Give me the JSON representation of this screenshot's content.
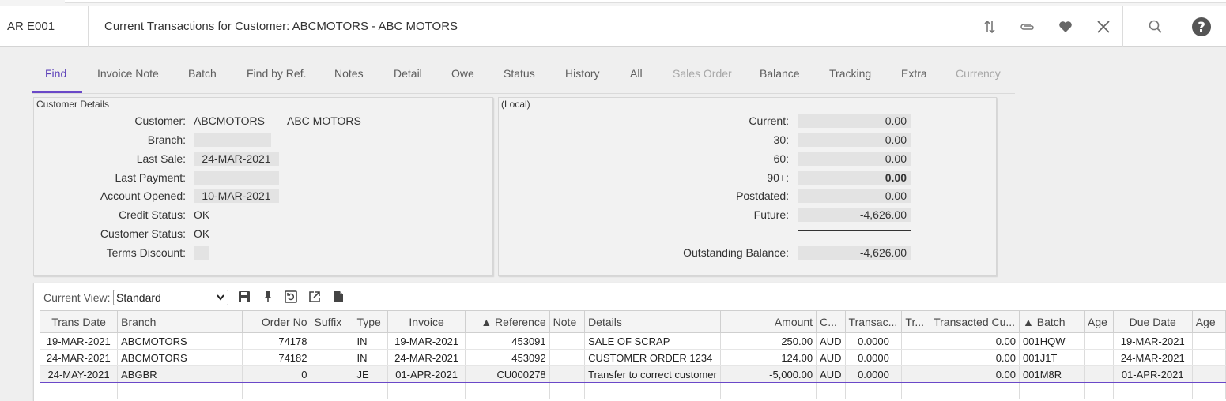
{
  "header": {
    "app_code": "AR E001",
    "title": "Current Transactions for Customer: ABCMOTORS - ABC MOTORS"
  },
  "tabs": [
    {
      "label": "Find"
    },
    {
      "label": "Invoice Note"
    },
    {
      "label": "Batch"
    },
    {
      "label": "Find by Ref."
    },
    {
      "label": "Notes"
    },
    {
      "label": "Detail"
    },
    {
      "label": "Owe"
    },
    {
      "label": "Status"
    },
    {
      "label": "History"
    },
    {
      "label": "All"
    },
    {
      "label": "Sales Order"
    },
    {
      "label": "Balance"
    },
    {
      "label": "Tracking"
    },
    {
      "label": "Extra"
    },
    {
      "label": "Currency"
    }
  ],
  "customer_details": {
    "title": "Customer Details",
    "customer_label": "Customer:",
    "customer_code": "ABCMOTORS",
    "customer_name": "ABC MOTORS",
    "branch_label": "Branch:",
    "branch": "",
    "last_sale_label": "Last Sale:",
    "last_sale": "24-MAR-2021",
    "last_payment_label": "Last Payment:",
    "last_payment": "",
    "account_opened_label": "Account Opened:",
    "account_opened": "10-MAR-2021",
    "credit_status_label": "Credit Status:",
    "credit_status": "OK",
    "customer_status_label": "Customer Status:",
    "customer_status": "OK",
    "terms_discount_label": "Terms Discount:",
    "terms_discount": ""
  },
  "aging": {
    "title": "(Local)",
    "current_label": "Current:",
    "current": "0.00",
    "d30_label": "30:",
    "d30": "0.00",
    "d60_label": "60:",
    "d60": "0.00",
    "d90_label": "90+:",
    "d90": "0.00",
    "postdated_label": "Postdated:",
    "postdated": "0.00",
    "future_label": "Future:",
    "future": "-4,626.00",
    "outstanding_label": "Outstanding Balance:",
    "outstanding": "-4,626.00"
  },
  "grid": {
    "current_view_label": "Current View:",
    "current_view": "Standard",
    "columns": [
      "Trans Date",
      "Branch",
      "Order No",
      "Suffix",
      "Type",
      "Invoice",
      "▲ Reference",
      "Note",
      "Details",
      "Amount",
      "C...",
      "Transac...",
      "Tr...",
      "Transacted Cu...",
      "▲ Batch",
      "Age",
      "Due Date",
      "Age"
    ],
    "rows": [
      [
        "19-MAR-2021",
        "ABCMOTORS",
        "74178",
        "",
        "IN",
        "19-MAR-2021",
        "453091",
        "",
        "SALE OF SCRAP",
        "250.00",
        "AUD",
        "0.0000",
        "",
        "0.00",
        "001HQW",
        "",
        "19-MAR-2021",
        ""
      ],
      [
        "24-MAR-2021",
        "ABCMOTORS",
        "74182",
        "",
        "IN",
        "24-MAR-2021",
        "453092",
        "",
        "CUSTOMER ORDER 1234",
        "124.00",
        "AUD",
        "0.0000",
        "",
        "0.00",
        "001J1T",
        "",
        "24-MAR-2021",
        ""
      ],
      [
        "24-MAY-2021",
        "ABGBR",
        "0",
        "",
        "JE",
        "01-APR-2021",
        "CU000278",
        "",
        "Transfer to correct customer",
        "-5,000.00",
        "AUD",
        "0.0000",
        "",
        "0.00",
        "001M8R",
        "",
        "01-APR-2021",
        ""
      ],
      [
        "",
        "",
        "",
        "",
        "",
        "",
        "",
        "",
        "",
        "",
        "",
        "",
        "",
        "",
        "",
        "",
        "",
        ""
      ]
    ]
  },
  "icons": {
    "sort": "sort-icon",
    "attach": "paperclip-icon",
    "favorite": "heart-icon",
    "close": "close-icon",
    "search": "search-icon",
    "help": "help-icon",
    "save": "save-icon",
    "pin": "pin-icon",
    "reset": "reset-icon",
    "export": "export-icon",
    "document": "document-icon"
  },
  "colors": {
    "accent": "#6a48c8",
    "field_bg": "#e3e3e3",
    "panel_bg": "#f2f2f2"
  }
}
